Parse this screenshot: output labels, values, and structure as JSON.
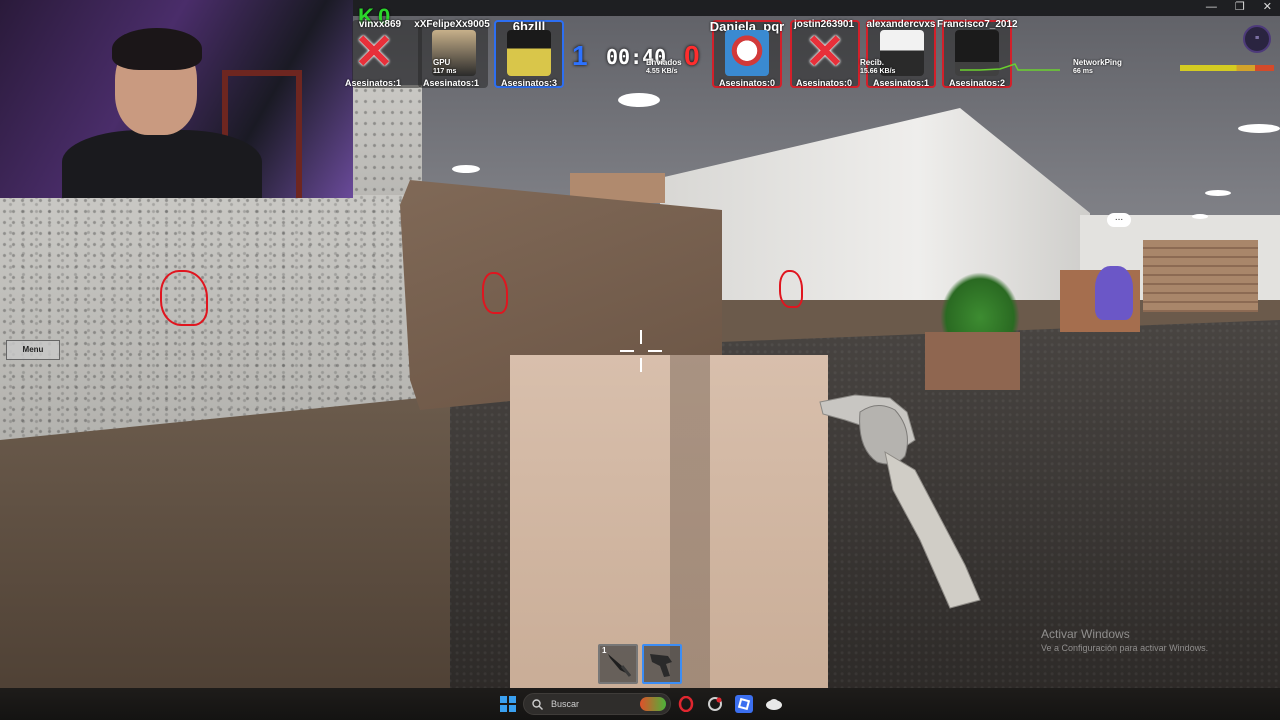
{
  "window": {
    "controls": [
      "—",
      "❐",
      "✕"
    ]
  },
  "hud": {
    "kill_indicator": "K 0",
    "score": {
      "blue": "1",
      "red": "0"
    },
    "timer": "00:40",
    "sent": {
      "label": "Enviados",
      "value": "4.55 KB/s"
    },
    "received": {
      "label": "Recib.",
      "value": "15.66 KB/s"
    },
    "gpu": {
      "label": "GPU",
      "value": "117 ms"
    },
    "network_ping": {
      "label": "NetworkPing",
      "value": "66 ms"
    },
    "players": [
      {
        "name": "vinxx869",
        "kills": "Asesinatos:1",
        "team": "neutral",
        "dead": true
      },
      {
        "name": "xXFelipeXx9005",
        "kills": "Asesinatos:1",
        "team": "neutral",
        "dead": false
      },
      {
        "name": "6hzlll",
        "kills": "Asesinatos:3",
        "team": "blue",
        "dead": false
      },
      {
        "name": "Daniela_pqr",
        "kills": "Asesinatos:0",
        "team": "red",
        "dead": false
      },
      {
        "name": "jostin263901",
        "kills": "Asesinatos:0",
        "team": "red",
        "dead": true
      },
      {
        "name": "alexandercvxs",
        "kills": "Asesinatos:1",
        "team": "red",
        "dead": false
      },
      {
        "name": "Francisco7_2012",
        "kills": "Asesinatos:2",
        "team": "red",
        "dead": false
      }
    ]
  },
  "menu": {
    "label": "Menu"
  },
  "hotbar": {
    "slot1_number": "1",
    "selected_slot": 2
  },
  "npc_indicator": "...",
  "watermark": {
    "title": "Activar Windows",
    "subtitle": "Ve a Configuración para activar Windows."
  },
  "taskbar": {
    "search_placeholder": "Buscar"
  },
  "colors": {
    "team_blue": "#2d6ff2",
    "team_red": "#d3202a",
    "kill_counter": "#2bd62b"
  }
}
